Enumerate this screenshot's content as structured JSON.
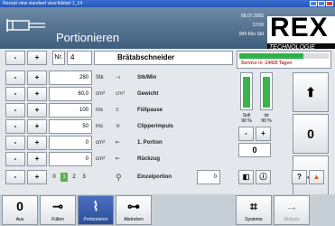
{
  "window": {
    "title": "Rezept view standard view.fidstart 1_14"
  },
  "header": {
    "title": "Portionieren",
    "date": "08.07.2005",
    "time": "12:00",
    "kilos": "840 Kilo Std",
    "brand": "REX",
    "brand_sub": "TECHNOLOGIE"
  },
  "recipe": {
    "minus": "-",
    "plus": "+",
    "nr_label": "Nr.",
    "nr": "4",
    "name": "Brätabschneider"
  },
  "params": [
    {
      "minus": "-",
      "plus": "+",
      "value": "280",
      "unit": "Stk",
      "icon": "⟞",
      "label": "Stk/Min"
    },
    {
      "minus": "-",
      "plus": "+",
      "value": "60,0",
      "unit": "cm³",
      "icon": "cm³",
      "label": "Gewicht"
    },
    {
      "minus": "-",
      "plus": "+",
      "value": "100",
      "unit": "ms",
      "icon": "≡",
      "label": "Füllpause"
    },
    {
      "minus": "-",
      "plus": "+",
      "value": "50",
      "unit": "ms",
      "icon": "≋",
      "label": "Clipperimpuls"
    },
    {
      "minus": "-",
      "plus": "+",
      "value": "0",
      "unit": "cm³",
      "icon": "⇤",
      "label": "1. Portion"
    },
    {
      "minus": "-",
      "plus": "+",
      "value": "0",
      "unit": "cm³",
      "icon": "⇤",
      "label": "Rückzug"
    }
  ],
  "einzel": {
    "minus": "-",
    "plus": "+",
    "steps": [
      "0",
      "1",
      "2",
      "3"
    ],
    "active_step": "1",
    "label": "Einzelportion",
    "value": "0"
  },
  "service": {
    "text": "Service in -14420 Tagen",
    "fill": 0.72
  },
  "gauges": {
    "soll_label": "Soll",
    "ist_label": "Ist",
    "soll": "90 %",
    "ist": "90 %",
    "soll_fill": 0.9,
    "ist_fill": 0.9
  },
  "right_controls": {
    "up": "⬆",
    "zero_big": "0",
    "down": "⬇",
    "minus": "-",
    "plus": "+",
    "zero": "0",
    "help": "?",
    "warn": "▲"
  },
  "toolbar": [
    {
      "icon": "0",
      "label": "Aus"
    },
    {
      "icon": "⊸",
      "label": "Füllen"
    },
    {
      "icon": "⌇",
      "label": "Portionieren"
    },
    {
      "icon": "⊶",
      "label": "Abdrehen"
    },
    {
      "icon": "⌗",
      "label": "Systeme"
    },
    {
      "icon": "→",
      "label": "Ablaufe"
    }
  ],
  "colors": {
    "accent": "#2fb14a",
    "header": "#3f5e7d"
  }
}
